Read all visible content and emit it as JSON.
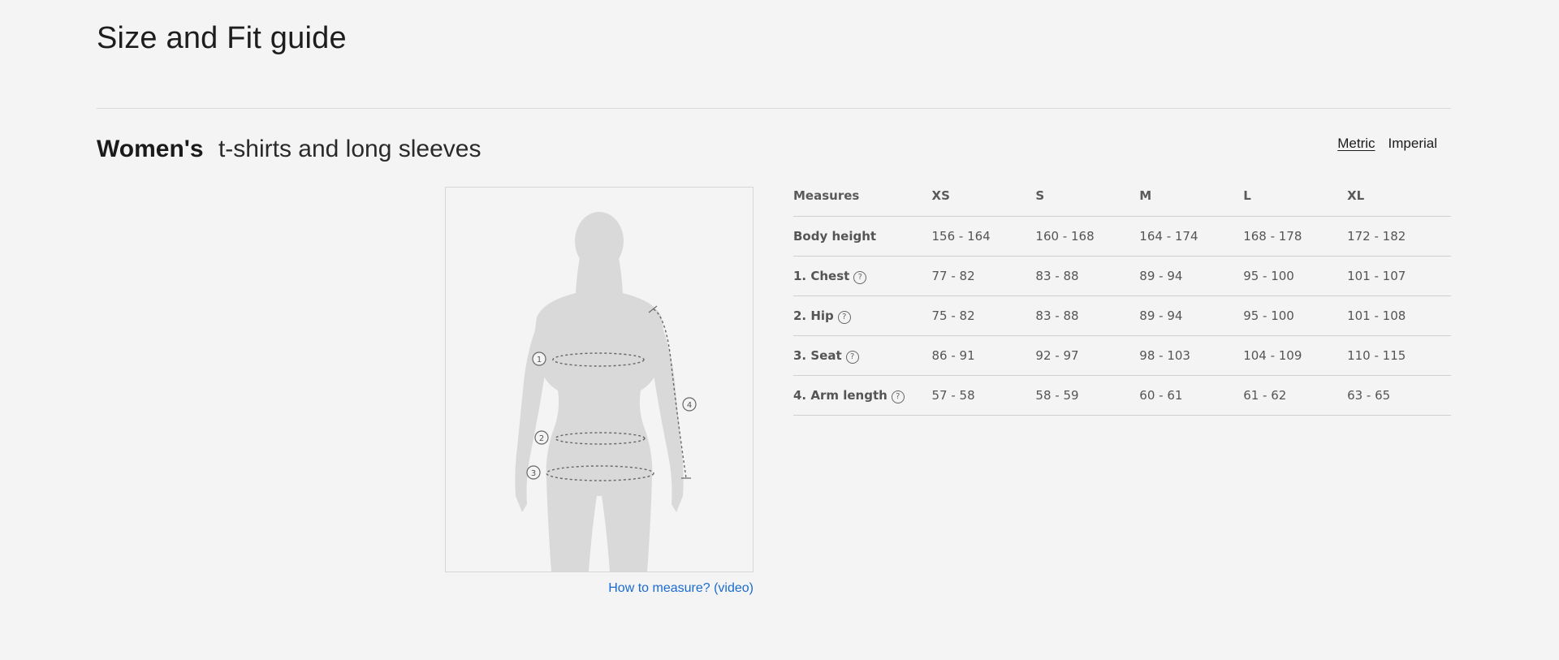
{
  "page": {
    "title": "Size and Fit guide"
  },
  "section": {
    "gender": "Women's",
    "category": "t-shirts and long sleeves"
  },
  "units": {
    "options": [
      "Metric",
      "Imperial"
    ],
    "selected": "Metric"
  },
  "figure": {
    "markers": [
      "1",
      "2",
      "3",
      "4"
    ],
    "link_label": "How to measure? (video)"
  },
  "table": {
    "headers": [
      "Measures",
      "XS",
      "S",
      "M",
      "L",
      "XL"
    ],
    "help_icon": "?",
    "rows": [
      {
        "label": "Body height",
        "help": false,
        "values": [
          "156 - 164",
          "160 - 168",
          "164 - 174",
          "168 - 178",
          "172 - 182"
        ]
      },
      {
        "label": "1. Chest",
        "help": true,
        "values": [
          "77 - 82",
          "83 - 88",
          "89 - 94",
          "95 - 100",
          "101 - 107"
        ]
      },
      {
        "label": "2. Hip",
        "help": true,
        "values": [
          "75 - 82",
          "83 - 88",
          "89 - 94",
          "95 - 100",
          "101 - 108"
        ]
      },
      {
        "label": "3. Seat",
        "help": true,
        "values": [
          "86 - 91",
          "92 - 97",
          "98 - 103",
          "104 - 109",
          "110 - 115"
        ]
      },
      {
        "label": "4. Arm length",
        "help": true,
        "values": [
          "57 - 58",
          "58 - 59",
          "60 - 61",
          "61 - 62",
          "63 - 65"
        ]
      }
    ]
  }
}
